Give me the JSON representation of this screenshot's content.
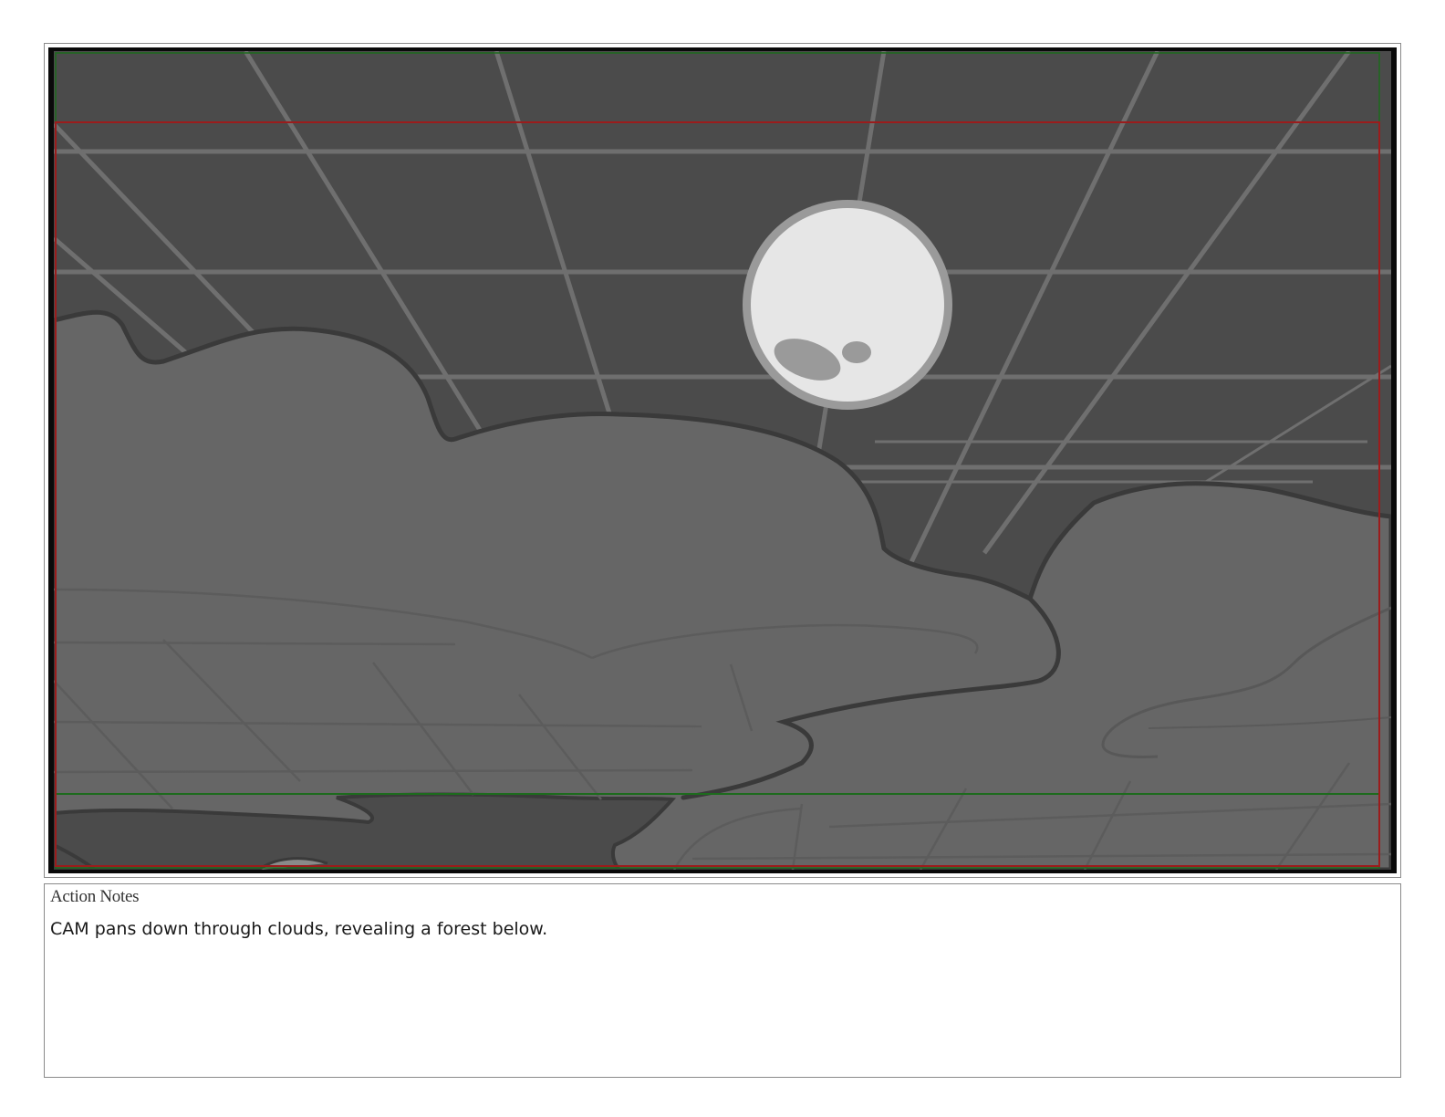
{
  "panel": {
    "image_description_icon": "storyboard-drawing-icon",
    "colors": {
      "sky": "#4b4b4b",
      "cloud": "#666666",
      "moon": "#e6e6e6",
      "moon_rim": "#9a9a9a",
      "title_safe": "#9b1c1c",
      "action_safe": "#1d6b1d",
      "frame": "#0a0a0a"
    }
  },
  "notes": {
    "title": "Action Notes",
    "text": "CAM pans down through clouds, revealing a forest below."
  }
}
